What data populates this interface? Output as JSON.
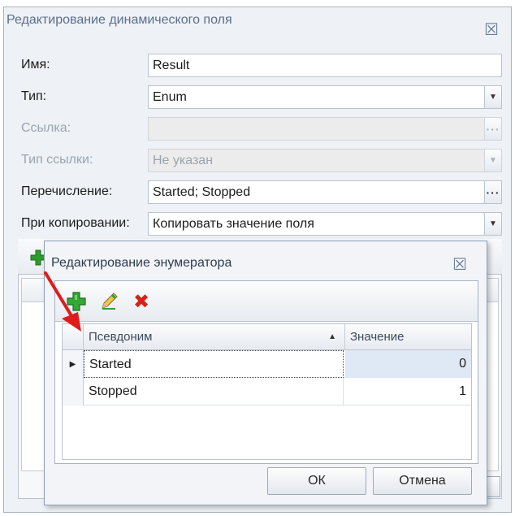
{
  "main_dialog": {
    "title": "Редактирование динамического поля",
    "close_glyph": "☒",
    "fields": {
      "name": {
        "label": "Имя:",
        "value": "Result"
      },
      "type": {
        "label": "Тип:",
        "value": "Enum"
      },
      "link": {
        "label": "Ссылка:",
        "value": ""
      },
      "link_type": {
        "label": "Тип ссылки:",
        "value": "Не указан"
      },
      "enumeration": {
        "label": "Перечисление:",
        "value": "Started; Stopped"
      },
      "on_copy": {
        "label": "При копировании:",
        "value": "Копировать значение поля"
      }
    },
    "dots_glyph": "···",
    "dropdown_glyph": "▼"
  },
  "enum_dialog": {
    "title": "Редактирование энумератора",
    "close_glyph": "☒",
    "toolbar": {
      "add_icon": "add-icon",
      "edit_icon": "pencil-icon",
      "delete_icon": "delete-x-icon",
      "delete_glyph": "✖"
    },
    "grid": {
      "columns": [
        "Псевдоним",
        "Значение"
      ],
      "sort_glyph": "▲",
      "row_indicator_glyph": "▶",
      "rows": [
        {
          "alias": "Started",
          "value": "0"
        },
        {
          "alias": "Stopped",
          "value": "1"
        }
      ]
    },
    "buttons": {
      "ok": "ОК",
      "cancel": "Отмена"
    }
  },
  "colors": {
    "arrow": "#e01b1b",
    "add_green": "#2e9b2e",
    "delete_red": "#d8201a",
    "selection": "#dfe8f5"
  }
}
